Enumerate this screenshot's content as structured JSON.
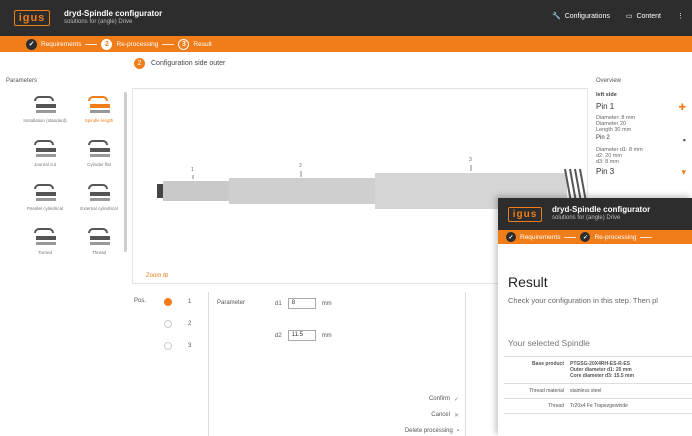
{
  "header": {
    "logo": "igus",
    "title": "dryd-Spindle configurator",
    "subtitle": "solutions for (angle) Drive",
    "nav": [
      {
        "label": "Configurations",
        "icon": "wrench-icon"
      },
      {
        "label": "Content",
        "icon": "calendar-icon"
      }
    ]
  },
  "steps": [
    {
      "num": "✓",
      "label": "Requirements"
    },
    {
      "num": "2",
      "label": "Re-processing"
    },
    {
      "num": "3",
      "label": "Result"
    }
  ],
  "config_header": {
    "badge": "2",
    "label": "Configuration side outer"
  },
  "sidebar": {
    "label": "Parameters",
    "tiles": [
      {
        "label": "Installation (standard)",
        "selected": false
      },
      {
        "label": "Spindle length",
        "selected": true
      },
      {
        "label": "Journal cut",
        "selected": false
      },
      {
        "label": "Cylinder flat",
        "selected": false
      },
      {
        "label": "Parallel cylindrical",
        "selected": false
      },
      {
        "label": "External cylindrical",
        "selected": false
      },
      {
        "label": "Turned",
        "selected": false
      },
      {
        "label": "Thread",
        "selected": false
      }
    ]
  },
  "canvas": {
    "zoom_label": "Zoom ⊞",
    "dims": [
      "1",
      "2",
      "3"
    ]
  },
  "overview": {
    "label": "Overview",
    "side": "left side",
    "pins": [
      {
        "title": "Pin 1",
        "lines": [
          "Diameter: 8 mm",
          "Diameter 20",
          "Length 30 mm"
        ]
      },
      {
        "title": "Pin 2",
        "lines": [
          "Diameter d1: 8 mm",
          "d2: 20 mm",
          "d3: 8 mm"
        ]
      },
      {
        "title": "Pin 3",
        "lines": []
      }
    ]
  },
  "position": {
    "label": "Pos.",
    "items": [
      "1",
      "2",
      "3"
    ]
  },
  "parameter": {
    "title": "Parameter",
    "fields": [
      {
        "label": "d1",
        "value": "8",
        "unit": "mm"
      },
      {
        "label": "d2",
        "value": "11.5",
        "unit": "mm"
      }
    ],
    "actions": [
      {
        "label": "Confirm",
        "icon": "✓"
      },
      {
        "label": "Cancel",
        "icon": "✕"
      },
      {
        "label": "Delete processing",
        "icon": "▪"
      }
    ]
  },
  "result": {
    "logo": "igus",
    "title": "dryd-Spindle configurator",
    "subtitle": "solutions for (angle) Drive",
    "steps": [
      {
        "num": "✓",
        "label": "Requirements"
      },
      {
        "num": "✓",
        "label": "Re-processing"
      }
    ],
    "heading": "Result",
    "description": "Check your configuration in this step. Then pl",
    "spindle_heading": "Your selected Spindle",
    "rows": [
      {
        "key": "Base product",
        "value": [
          "PTGSG-20X4RH-ES-R-ES",
          "Outer diameter d1: 20 mm",
          "Core diameter d3: 15.5 mm"
        ],
        "bold": true
      },
      {
        "key": "Thread material",
        "value": [
          "stainless steel"
        ],
        "bold": false
      },
      {
        "key": "Thread",
        "value": [
          "Tr20x4 Fe Trapezgewinde"
        ],
        "bold": false
      }
    ]
  }
}
